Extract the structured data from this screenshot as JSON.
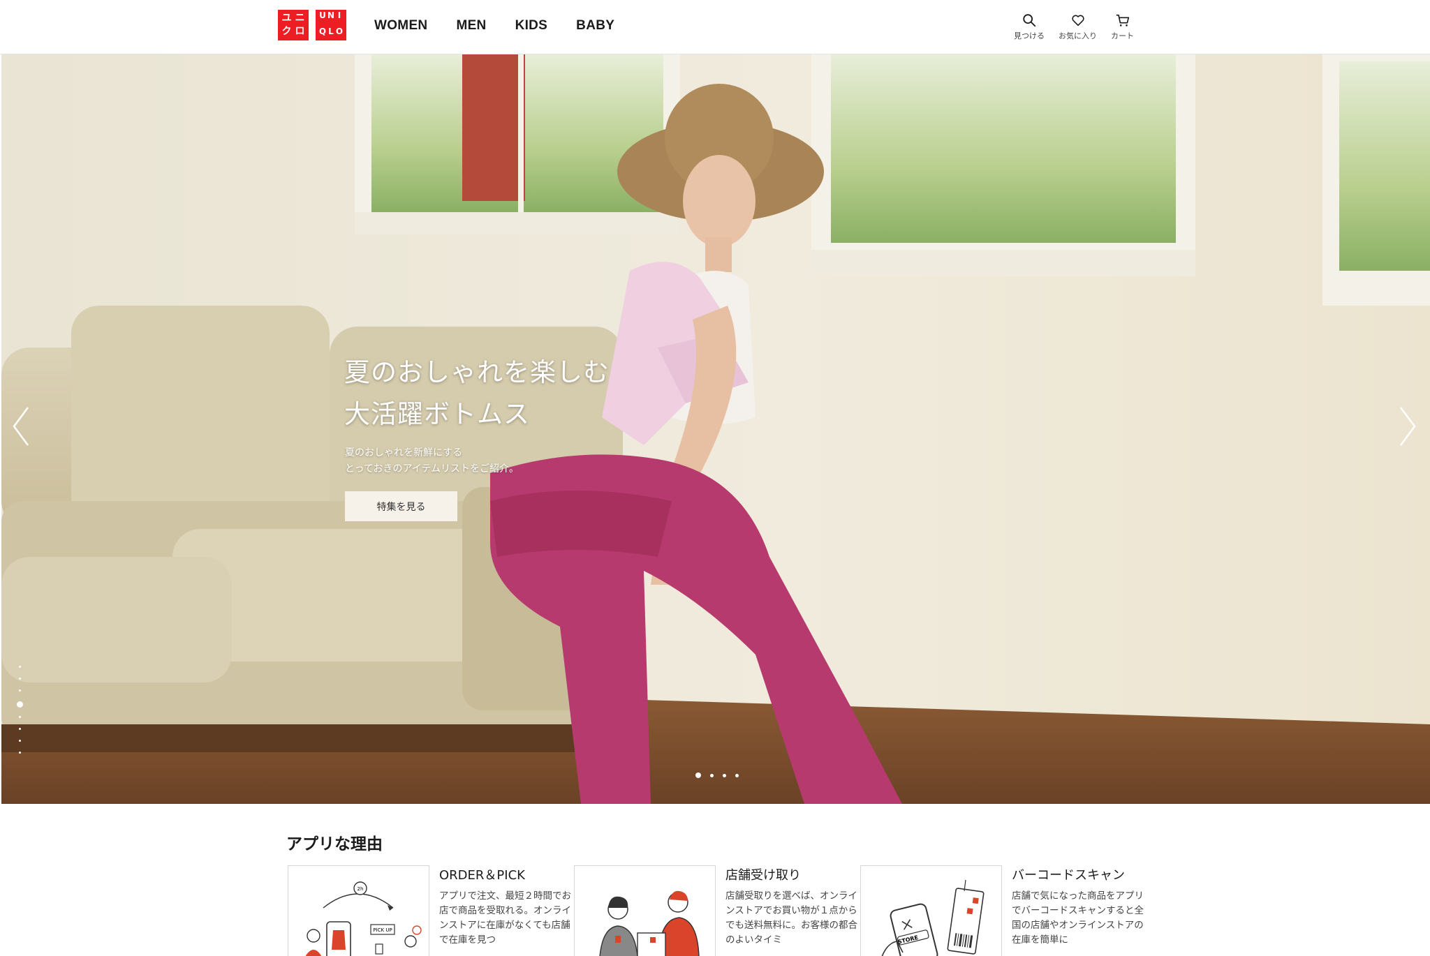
{
  "header": {
    "logo_left": [
      "ユ",
      "ニ",
      "ク",
      "ロ"
    ],
    "logo_right": [
      "U",
      "N",
      "I",
      "Q",
      "L",
      "O"
    ],
    "nav": [
      "WOMEN",
      "MEN",
      "KIDS",
      "BABY"
    ],
    "utils": [
      {
        "label": "見つける",
        "icon": "search-icon"
      },
      {
        "label": "お気に入り",
        "icon": "heart-icon"
      },
      {
        "label": "カート",
        "icon": "cart-icon"
      }
    ]
  },
  "hero": {
    "title_line1": "夏のおしゃれを楽しむ",
    "title_line2": "大活躍ボトムス",
    "desc_line1": "夏のおしゃれを新鮮にする",
    "desc_line2": "とっておきのアイテムリストをご紹介。",
    "cta": "特集を見る",
    "vertical_dots": 8,
    "vertical_active": 3,
    "horizontal_dots": 4,
    "horizontal_active": 0
  },
  "app_section": {
    "title": "アプリな理由",
    "cards": [
      {
        "title": "ORDER＆PICK",
        "body": "アプリで注文、最短２時間でお店で商品を受取れる。オンラインストアに在庫がなくても店舗で在庫を見つ",
        "illustration_label": "PICK UP",
        "illustration_time": "2h"
      },
      {
        "title": "店舗受け取り",
        "body": "店舗受取りを選べば、オンラインストアでお買い物が１点からでも送料無料に。お客様の都合のよいタイミ"
      },
      {
        "title": "バーコードスキャン",
        "body": "店舗で気になった商品をアプリでバーコードスキャンすると全国の店舗やオンラインストアの在庫を簡単に",
        "illustration_label": "STORE"
      }
    ]
  },
  "colors": {
    "brand_red": "#ed1d24",
    "pants": "#b73a6e",
    "wall": "#ebe5d6"
  }
}
